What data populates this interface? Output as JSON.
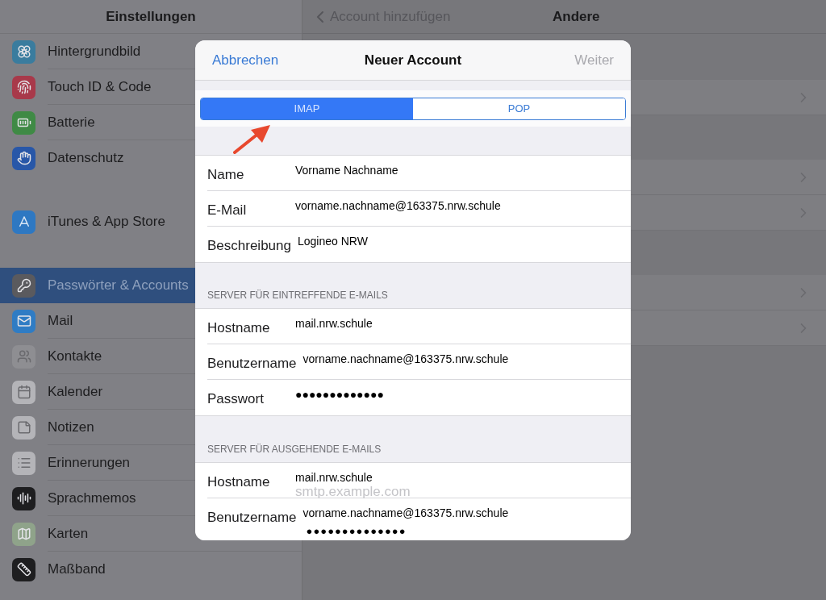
{
  "sidebar": {
    "title": "Einstellungen",
    "groups": [
      [
        {
          "label": "Hintergrundbild",
          "color": "#3a7c9e",
          "selected": false
        },
        {
          "label": "Touch ID & Code",
          "color": "#a8394a",
          "selected": false
        },
        {
          "label": "Batterie",
          "color": "#3f8a45",
          "selected": false
        },
        {
          "label": "Datenschutz",
          "color": "#2857a8",
          "selected": false
        }
      ],
      [
        {
          "label": "iTunes & App Store",
          "color": "#2e78c2",
          "selected": false
        }
      ],
      [
        {
          "label": "Passwörter & Accounts",
          "color": "#5a5a5e",
          "selected": true
        },
        {
          "label": "Mail",
          "color": "#2f7cc4",
          "selected": false
        },
        {
          "label": "Kontakte",
          "color": "#8e8e92",
          "selected": false
        },
        {
          "label": "Kalender",
          "color": "#b4b4b8",
          "selected": false
        },
        {
          "label": "Notizen",
          "color": "#b4b4b8",
          "selected": false
        },
        {
          "label": "Erinnerungen",
          "color": "#b4b4b8",
          "selected": false
        },
        {
          "label": "Sprachmemos",
          "color": "#1e1e20",
          "selected": false
        },
        {
          "label": "Karten",
          "color": "#8fa38a",
          "selected": false
        },
        {
          "label": "Maßband",
          "color": "#1e1e20",
          "selected": false
        }
      ]
    ]
  },
  "detail": {
    "back": "Account hinzufügen",
    "title": "Andere"
  },
  "dialog": {
    "cancel": "Abbrechen",
    "title": "Neuer Account",
    "next": {
      "label": "Weiter",
      "disabled": true
    },
    "segments": [
      {
        "label": "IMAP",
        "selected": true
      },
      {
        "label": "POP",
        "selected": false
      }
    ],
    "sections": [
      {
        "rows": [
          {
            "label": "Name",
            "value": "Vorname Nachname"
          },
          {
            "label": "E-Mail",
            "value": "vorname.nachname@163375.nrw.schule"
          },
          {
            "label": "Beschreibung",
            "value": "Logineo NRW"
          }
        ]
      },
      {
        "header": "SERVER FÜR EINTREFFENDE E-MAILS",
        "rows": [
          {
            "label": "Hostname",
            "value": "mail.nrw.schule"
          },
          {
            "label": "Benutzername",
            "value": "vorname.nachname@163375.nrw.schule"
          },
          {
            "label": "Passwort",
            "value": "●●●●●●●●●●●●●"
          }
        ]
      },
      {
        "header": "SERVER FÜR AUSGEHENDE E-MAILS",
        "rows": [
          {
            "label": "Hostname",
            "value": "mail.nrw.schule",
            "placeholder": "smtp.example.com"
          },
          {
            "label": "Benutzername",
            "value": "vorname.nachname@163375.nrw.schule",
            "extra": "●●●●●●●●●●●●●●"
          }
        ]
      }
    ]
  }
}
